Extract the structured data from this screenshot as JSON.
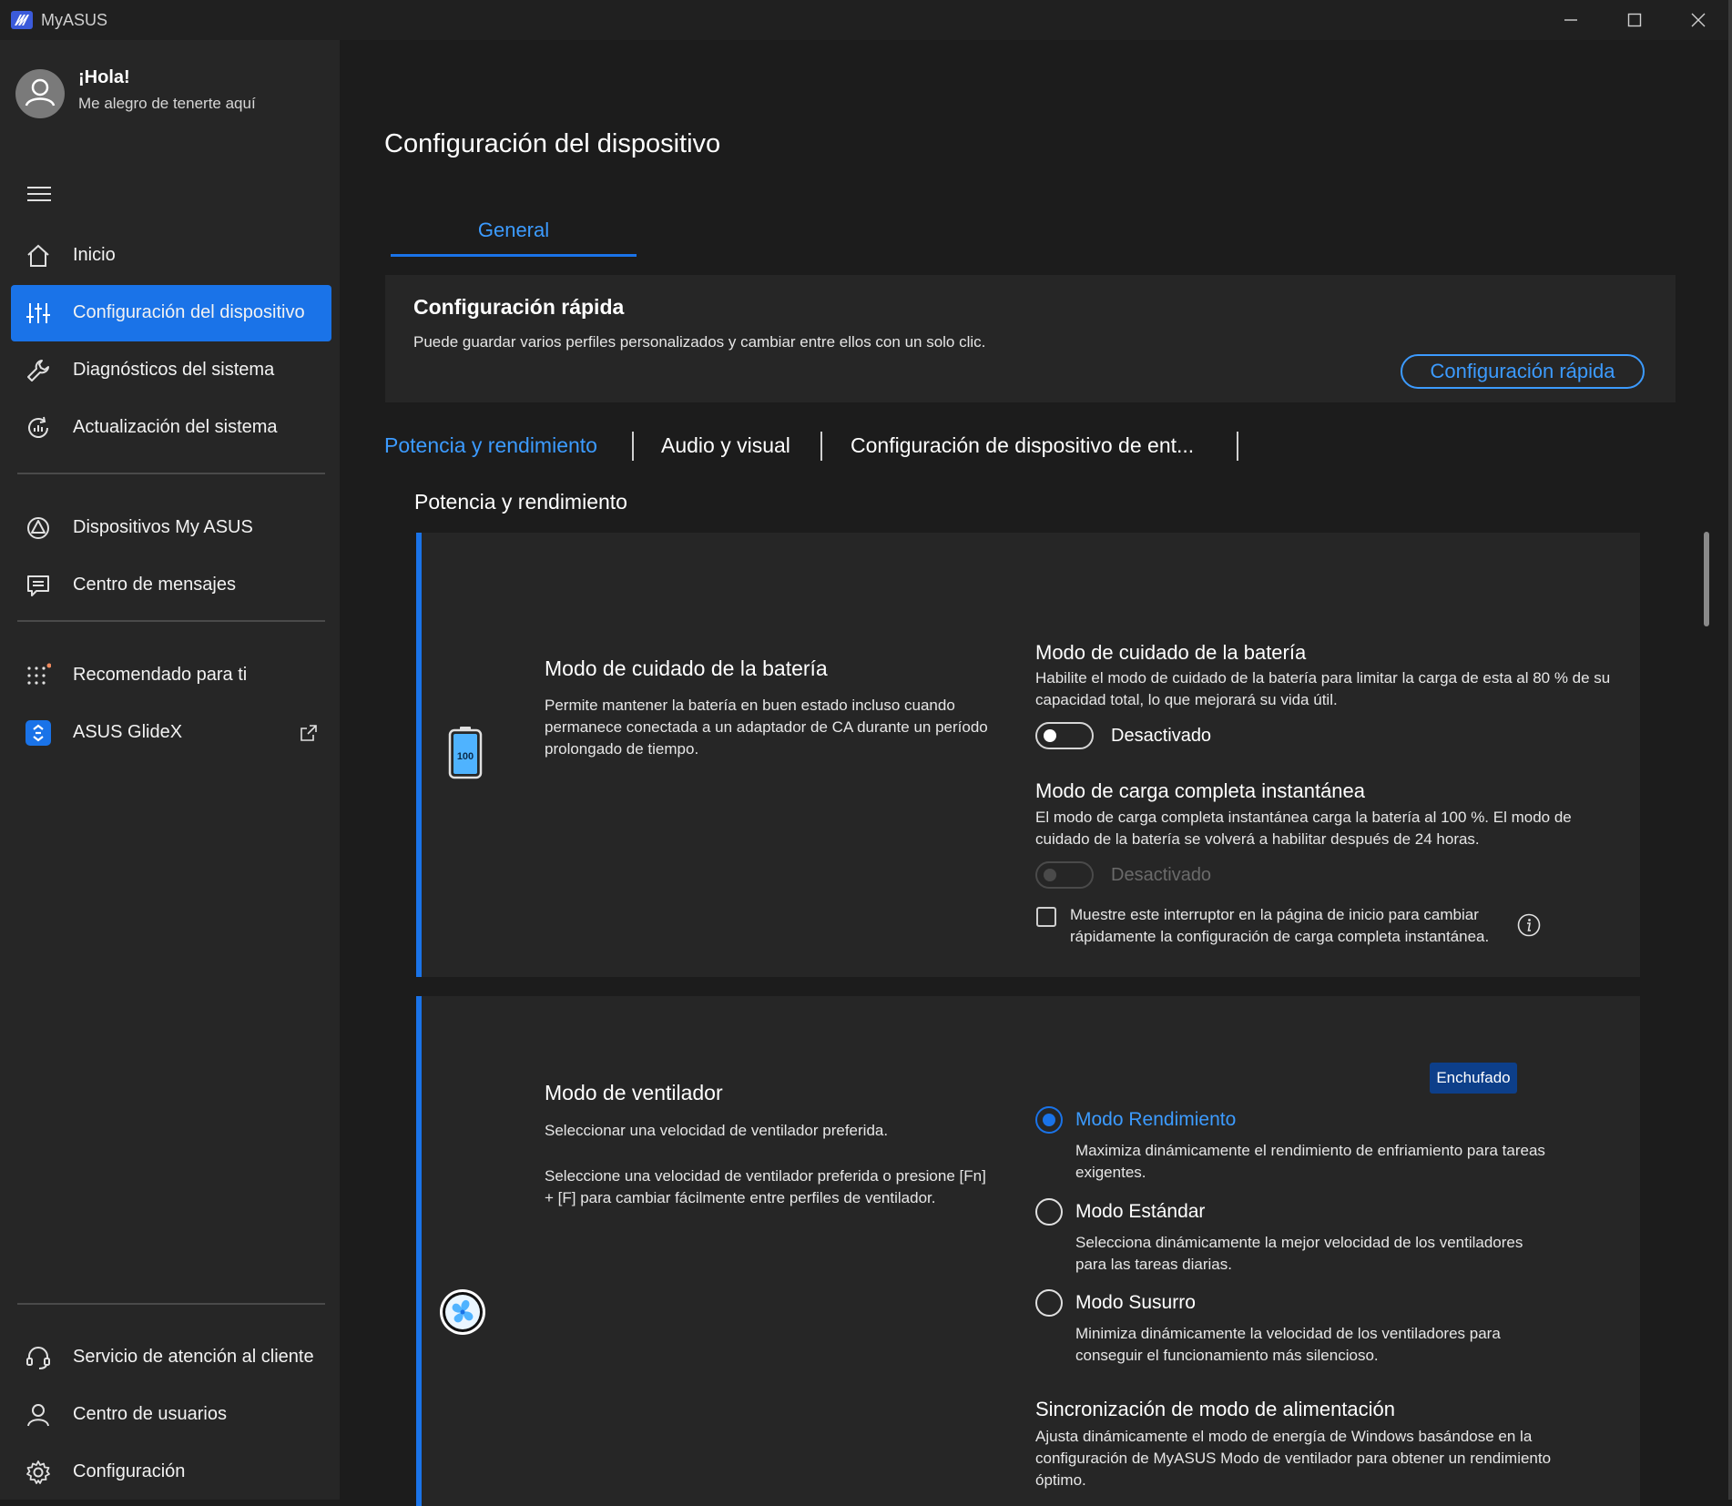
{
  "window": {
    "title": "MyASUS",
    "controls": [
      "minimize-icon",
      "maximize-icon",
      "close-icon"
    ]
  },
  "user": {
    "greeting": "¡Hola!",
    "subtitle": "Me alegro de tenerte aquí"
  },
  "sidebar": {
    "items": [
      {
        "label": "Inicio",
        "icon": "home-icon"
      },
      {
        "label": "Configuración del dispositivo",
        "icon": "sliders-icon",
        "active": true
      },
      {
        "label": "Diagnósticos del sistema",
        "icon": "wrench-icon"
      },
      {
        "label": "Actualización del sistema",
        "icon": "update-icon"
      },
      {
        "label": "Dispositivos My ASUS",
        "icon": "devices-icon"
      },
      {
        "label": "Centro de mensajes",
        "icon": "message-icon"
      },
      {
        "label": "Recomendado para ti",
        "icon": "apps-dots-icon"
      },
      {
        "label": "ASUS GlideX",
        "icon": "glidex-icon"
      }
    ],
    "bottom_items": [
      {
        "label": "Servicio de atención al cliente",
        "icon": "headset-icon"
      },
      {
        "label": "Centro de usuarios",
        "icon": "user-icon"
      },
      {
        "label": "Configuración",
        "icon": "gear-icon"
      }
    ]
  },
  "main": {
    "page_title": "Configuración del dispositivo",
    "tab": "General",
    "quick": {
      "title": "Configuración rápida",
      "description": "Puede guardar varios perfiles personalizados y cambiar entre ellos con un solo clic.",
      "button": "Configuración rápida"
    },
    "subtabs": [
      "Potencia y rendimiento",
      "Audio y visual",
      "Configuración de dispositivo de ent..."
    ],
    "section_title": "Potencia y rendimiento",
    "battery": {
      "title": "Modo de cuidado de la batería",
      "description": "Permite mantener la batería en buen estado incluso cuando permanece conectada a un adaptador de CA durante un período prolongado de tiempo.",
      "icon_text": "100",
      "care": {
        "title": "Modo de cuidado de la batería",
        "description": "Habilite el modo de cuidado de la batería para limitar la carga de esta al 80 % de su capacidad total, lo que mejorará su vida útil.",
        "state": "Desactivado"
      },
      "instant": {
        "title": "Modo de carga completa instantánea",
        "description": "El modo de carga completa instantánea carga la batería al 100 %. El modo de cuidado de la batería se volverá a habilitar después de 24 horas.",
        "state": "Desactivado"
      },
      "checkbox": "Muestre este interruptor en la página de inicio para cambiar rápidamente la configuración de carga completa instantánea."
    },
    "fan": {
      "title": "Modo de ventilador",
      "description1": "Seleccionar una velocidad de ventilador preferida.",
      "description2": "Seleccione una velocidad de ventilador preferida o presione [Fn] + [F] para cambiar fácilmente entre perfiles de ventilador.",
      "badge": "Enchufado",
      "options": [
        {
          "label": "Modo Rendimiento",
          "description": "Maximiza dinámicamente el rendimiento de enfriamiento para tareas exigentes.",
          "selected": true
        },
        {
          "label": "Modo Estándar",
          "description": "Selecciona dinámicamente la mejor velocidad de los ventiladores para las tareas diarias.",
          "selected": false
        },
        {
          "label": "Modo Susurro",
          "description": "Minimiza dinámicamente la velocidad de los ventiladores para conseguir el funcionamiento más silencioso.",
          "selected": false
        }
      ],
      "sync": {
        "title": "Sincronización de modo de alimentación",
        "description": "Ajusta dinámicamente el modo de energía de Windows basándose en la configuración de MyASUS Modo de ventilador para obtener un rendimiento óptimo."
      }
    }
  },
  "colors": {
    "accent": "#1a73e8",
    "accent_text": "#3c9bff",
    "badge": "#0d3f8a",
    "background": "#1c1c1c",
    "sidebar": "#262626"
  }
}
